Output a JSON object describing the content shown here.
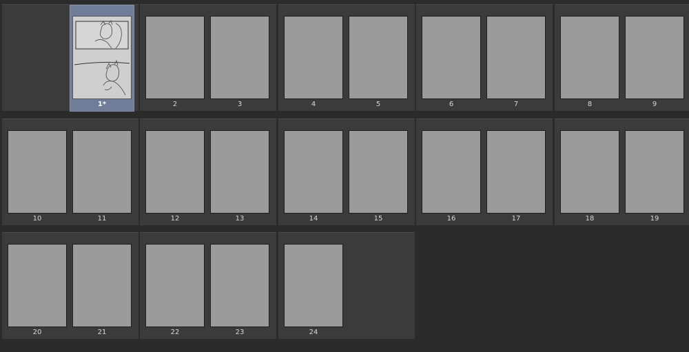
{
  "spreads": [
    {
      "left": null,
      "right": {
        "label": "1*",
        "selected": true,
        "sketch": true
      }
    },
    {
      "left": {
        "label": "2"
      },
      "right": {
        "label": "3"
      }
    },
    {
      "left": {
        "label": "4"
      },
      "right": {
        "label": "5"
      }
    },
    {
      "left": {
        "label": "6"
      },
      "right": {
        "label": "7"
      }
    },
    {
      "left": {
        "label": "8"
      },
      "right": {
        "label": "9"
      }
    },
    {
      "left": {
        "label": "10"
      },
      "right": {
        "label": "11"
      }
    },
    {
      "left": {
        "label": "12"
      },
      "right": {
        "label": "13"
      }
    },
    {
      "left": {
        "label": "14"
      },
      "right": {
        "label": "15"
      }
    },
    {
      "left": {
        "label": "16"
      },
      "right": {
        "label": "17"
      }
    },
    {
      "left": {
        "label": "18"
      },
      "right": {
        "label": "19"
      }
    },
    {
      "left": {
        "label": "20"
      },
      "right": {
        "label": "21"
      }
    },
    {
      "left": {
        "label": "22"
      },
      "right": {
        "label": "23"
      }
    },
    {
      "left": {
        "label": "24"
      },
      "right": null
    }
  ]
}
